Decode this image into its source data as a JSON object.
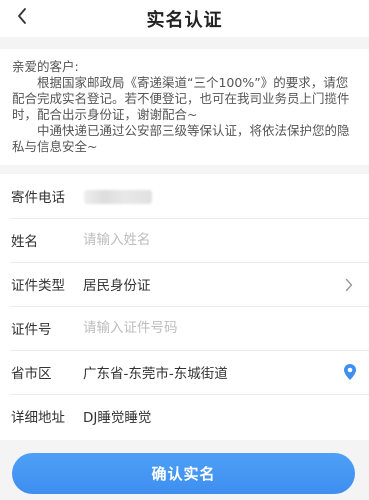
{
  "header": {
    "title": "实名认证"
  },
  "notice": {
    "greeting": "亲爱的客户:",
    "paragraph1": "根据国家邮政局《寄递渠道“三个100%”》的要求，请您配合完成实名登记。若不便登记，也可在我司业务员上门揽件时，配合出示身份证，谢谢配合~",
    "paragraph2": "中通快递已通过公安部三级等保认证，将依法保护您的隐私与信息安全~"
  },
  "form": {
    "phone": {
      "label": "寄件电话"
    },
    "name": {
      "label": "姓名",
      "placeholder": "请输入姓名"
    },
    "id_type": {
      "label": "证件类型",
      "value": "居民身份证"
    },
    "id_number": {
      "label": "证件号",
      "placeholder": "请输入证件号码"
    },
    "region": {
      "label": "省市区",
      "value": "广东省-东莞市-东城街道"
    },
    "address": {
      "label": "详细地址",
      "value": "DJ睡觉睡觉"
    }
  },
  "submit_label": "确认实名",
  "colors": {
    "accent": "#3f8ef0",
    "background": "#f4f4f4"
  }
}
